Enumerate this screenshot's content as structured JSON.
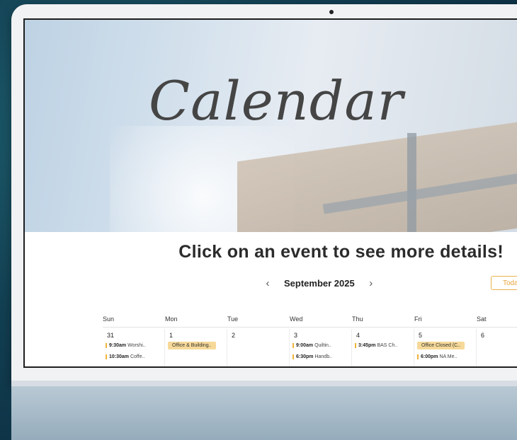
{
  "hero": {
    "title": "Calendar"
  },
  "instruction": "Click on an event to see more details!",
  "nav": {
    "prev": "‹",
    "month": "September 2025",
    "next": "›",
    "today": "Today"
  },
  "weekdays": [
    "Sun",
    "Mon",
    "Tue",
    "Wed",
    "Thu",
    "Fri",
    "Sat"
  ],
  "days": [
    {
      "num": "31",
      "events": [
        {
          "time": "9:30am",
          "title": "Worshi.."
        },
        {
          "time": "10:30am",
          "title": "Coffe.."
        }
      ]
    },
    {
      "num": "1",
      "events": [
        {
          "title": "Office & Building.."
        }
      ]
    },
    {
      "num": "2",
      "events": []
    },
    {
      "num": "3",
      "events": [
        {
          "time": "9:00am",
          "title": "Quiltin.."
        },
        {
          "time": "6:30pm",
          "title": "Handb.."
        }
      ]
    },
    {
      "num": "4",
      "events": [
        {
          "time": "3:45pm",
          "title": "BAS Ch.."
        }
      ]
    },
    {
      "num": "5",
      "events": [
        {
          "title": "Office Closed (C.."
        },
        {
          "time": "6:00pm",
          "title": "NA Me.."
        }
      ]
    },
    {
      "num": "6",
      "events": []
    }
  ],
  "colors": {
    "accent": "#f0b33a",
    "chip": "#f6d999",
    "bezel": "#1e1e1e"
  }
}
